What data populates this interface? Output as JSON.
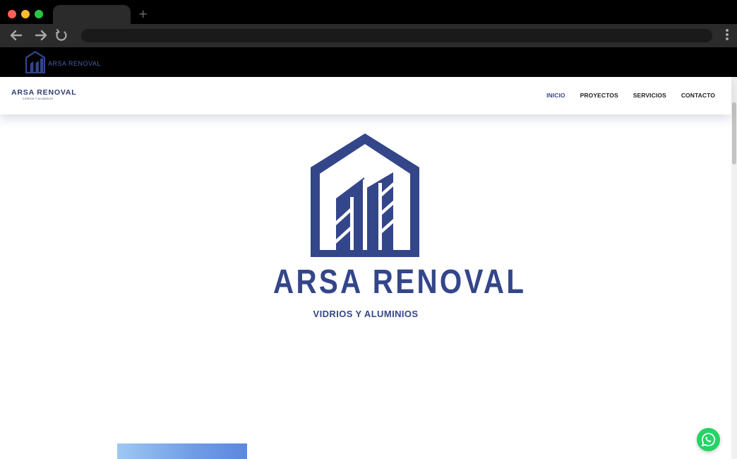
{
  "browser": {
    "new_tab_glyph": "+",
    "icons": [
      "back-arrow-icon",
      "forward-arrow-icon",
      "reload-icon",
      "kebab-menu-icon"
    ]
  },
  "top_strip": {
    "brand": "ARSA RENOVAL"
  },
  "header": {
    "brand_name": "ARSA RENOVAL",
    "brand_tagline": "VIDRIOS Y ALUMINIOS",
    "nav": [
      {
        "label": "INICIO",
        "active": true
      },
      {
        "label": "PROYECTOS",
        "active": false
      },
      {
        "label": "SERVICIOS",
        "active": false
      },
      {
        "label": "CONTACTO",
        "active": false
      }
    ]
  },
  "hero": {
    "title": "ARSA RENOVAL",
    "subtitle": "VIDRIOS Y ALUMINIOS"
  },
  "colors": {
    "brand_blue": "#34468a",
    "nav_active": "#3a4a8c",
    "whatsapp_green": "#25d366",
    "gradient_start": "#9ec8f2",
    "gradient_end": "#5b88e0"
  },
  "floating": {
    "icon": "whatsapp-icon"
  }
}
